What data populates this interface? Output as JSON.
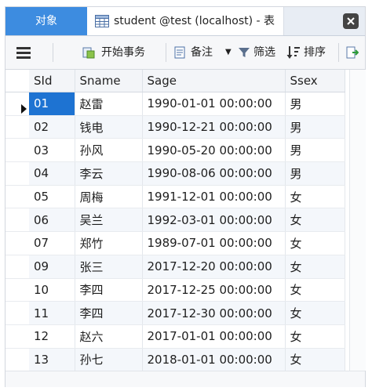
{
  "tabs": {
    "objects_label": "对象",
    "table_tab_title": "student @test (localhost) - 表"
  },
  "toolbar": {
    "begin_transaction": "开始事务",
    "memo": "备注",
    "filter": "筛选",
    "sort": "排序"
  },
  "table": {
    "columns": [
      "SId",
      "Sname",
      "Sage",
      "Ssex"
    ],
    "rows": [
      [
        "01",
        "赵雷",
        "1990-01-01 00:00:00",
        "男"
      ],
      [
        "02",
        "钱电",
        "1990-12-21 00:00:00",
        "男"
      ],
      [
        "03",
        "孙风",
        "1990-05-20 00:00:00",
        "男"
      ],
      [
        "04",
        "李云",
        "1990-08-06 00:00:00",
        "男"
      ],
      [
        "05",
        "周梅",
        "1991-12-01 00:00:00",
        "女"
      ],
      [
        "06",
        "吴兰",
        "1992-03-01 00:00:00",
        "女"
      ],
      [
        "07",
        "郑竹",
        "1989-07-01 00:00:00",
        "女"
      ],
      [
        "09",
        "张三",
        "2017-12-20 00:00:00",
        "女"
      ],
      [
        "10",
        "李四",
        "2017-12-25 00:00:00",
        "女"
      ],
      [
        "11",
        "李四",
        "2017-12-30 00:00:00",
        "女"
      ],
      [
        "12",
        "赵六",
        "2017-01-01 00:00:00",
        "女"
      ],
      [
        "13",
        "孙七",
        "2018-01-01 00:00:00",
        "女"
      ]
    ],
    "selected_row": 0
  },
  "colors": {
    "accent": "#3d8ce0",
    "selection": "#1e73d2",
    "alt_row": "#f4f7fb"
  }
}
